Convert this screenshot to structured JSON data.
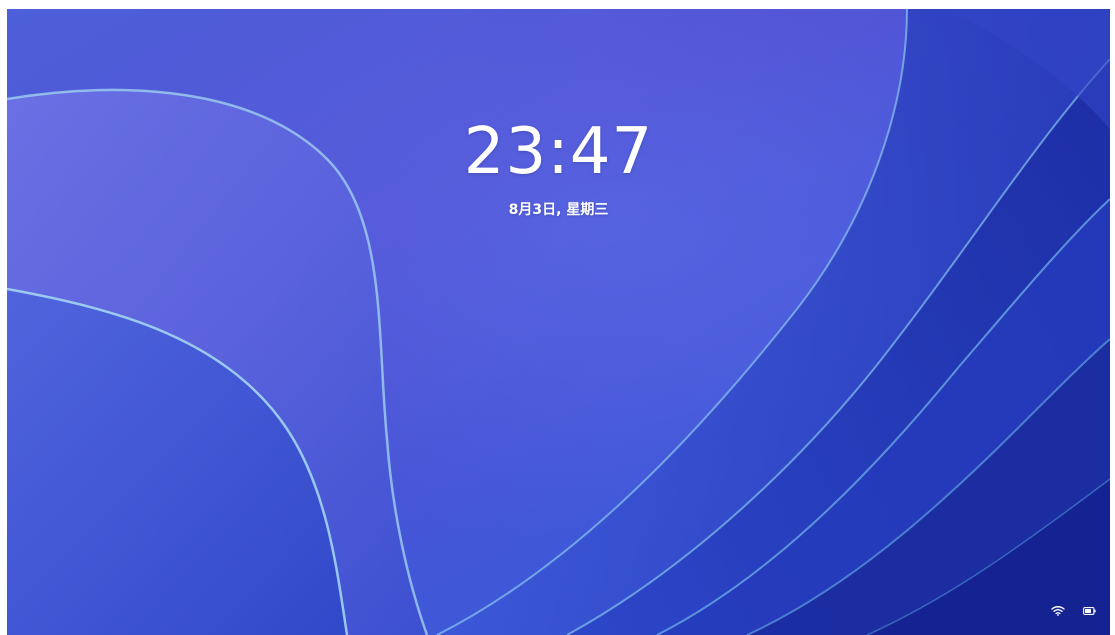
{
  "lock_screen": {
    "time": "23:47",
    "date": "8月3日, 星期三"
  },
  "status_bar": {
    "icons": [
      "wifi-icon",
      "battery-icon"
    ]
  },
  "colors": {
    "wallpaper_base": "#3f55d6",
    "wallpaper_purple": "#5d52d6",
    "wallpaper_dark": "#1d2fa8",
    "text": "#ffffff"
  }
}
